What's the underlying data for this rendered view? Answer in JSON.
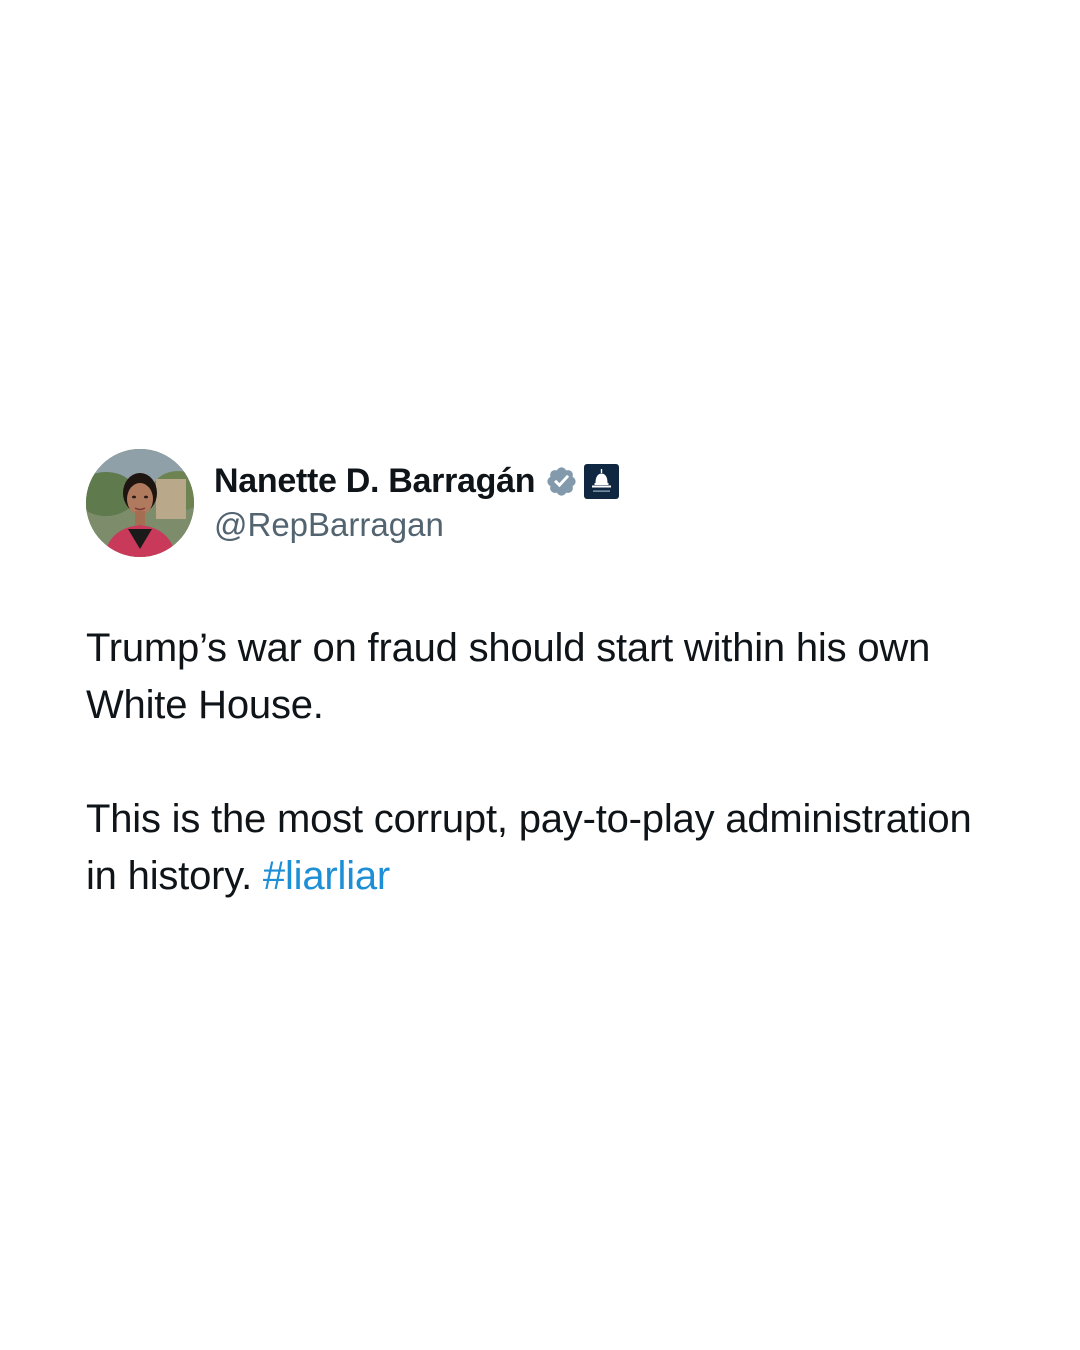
{
  "tweet": {
    "author": {
      "name": "Nanette D. Barragán",
      "handle": "@RepBarragan",
      "verified_icon": "verified-badge-icon",
      "affiliation_icon": "capitol-dome-icon"
    },
    "text": {
      "para1": "Trump’s war on fraud should start within his own White House.",
      "para2_text": "This is the most corrupt, pay-to-play administration in history. ",
      "hashtag": "#liarliar"
    }
  },
  "colors": {
    "name": "#0f1419",
    "handle": "#536471",
    "hashtag": "#1d8fd6",
    "verified_badge": "#829aab",
    "affiliation_badge": "#0f2740"
  }
}
